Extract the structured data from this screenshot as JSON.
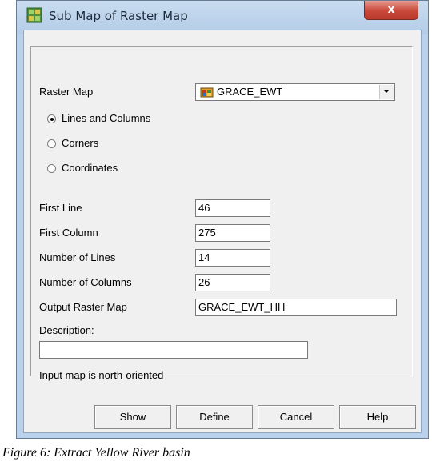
{
  "window": {
    "title": "Sub Map of Raster Map",
    "close_glyph": "x"
  },
  "form": {
    "raster_map_label": "Raster Map",
    "raster_map_value": "GRACE_EWT",
    "raster_map_icon": "raster-map-icon",
    "radio_options": [
      {
        "label": "Lines and Columns",
        "selected": true
      },
      {
        "label": "Corners",
        "selected": false
      },
      {
        "label": "Coordinates",
        "selected": false
      }
    ],
    "first_line_label": "First Line",
    "first_line_value": "46",
    "first_column_label": "First Column",
    "first_column_value": "275",
    "num_lines_label": "Number of Lines",
    "num_lines_value": "14",
    "num_columns_label": "Number of Columns",
    "num_columns_value": "26",
    "output_label": "Output Raster Map",
    "output_value": "GRACE_EWT_HH",
    "description_label": "Description:",
    "description_value": "",
    "note": "Input map is north-oriented"
  },
  "buttons": {
    "show": "Show",
    "define": "Define",
    "cancel": "Cancel",
    "help": "Help"
  },
  "caption": "Figure 6: Extract Yellow River basin",
  "colors": {
    "titlebar": "#b9d1ea",
    "close": "#c9483a",
    "client": "#f0f0f0"
  }
}
